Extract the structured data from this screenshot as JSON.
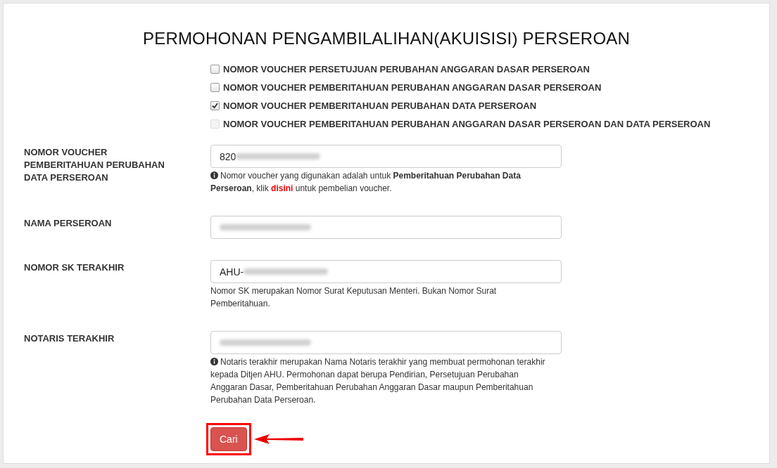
{
  "title": "PERMOHONAN PENGAMBILALIHAN(AKUISISI) PERSEROAN",
  "voucher_options": [
    {
      "label": "NOMOR VOUCHER PERSETUJUAN PERUBAHAN ANGGARAN DASAR PERSEROAN",
      "checked": false,
      "disabled": false
    },
    {
      "label": "NOMOR VOUCHER PEMBERITAHUAN PERUBAHAN ANGGARAN DASAR PERSEROAN",
      "checked": false,
      "disabled": false
    },
    {
      "label": "NOMOR VOUCHER PEMBERITAHUAN PERUBAHAN DATA PERSEROAN",
      "checked": true,
      "disabled": false
    },
    {
      "label": "NOMOR VOUCHER PEMBERITAHUAN PERUBAHAN ANGGARAN DASAR PERSEROAN DAN DATA PERSEROAN",
      "checked": false,
      "disabled": true
    }
  ],
  "fields": [
    {
      "label": "NOMOR VOUCHER PEMBERITAHUAN PERUBAHAN DATA PERSEROAN",
      "value": "820",
      "redacted": true,
      "help_icon": true,
      "help": "Nomor voucher yang digunakan adalah untuk **Pemberitahuan Perubahan Data Perseroan**, klik",
      "help_link": "disini",
      "help_after": "untuk pembelian voucher."
    },
    {
      "label": "NAMA PERSEROAN",
      "redacted": true
    },
    {
      "label": "NOMOR SK TERAKHIR",
      "value": "AHU-",
      "redacted": true,
      "help_icon": false,
      "help": "Nomor SK merupakan Nomor Surat Keputusan Menteri. Bukan Nomor Surat Pemberitahuan."
    },
    {
      "label": "NOTARIS TERAKHIR",
      "redacted": true,
      "help_icon": true,
      "help": "Notaris terakhir merupakan Nama Notaris terakhir yang membuat permohonan terakhir kepada Ditjen AHU. Permohonan dapat berupa Pendirian, Persetujuan Perubahan Anggaran Dasar, Pemberitahuan Perubahan Anggaran Dasar maupun Pemberitahuan Perubahan Data Perseroan."
    }
  ],
  "submit_button": {
    "label": "Cari",
    "highlighted": true
  }
}
